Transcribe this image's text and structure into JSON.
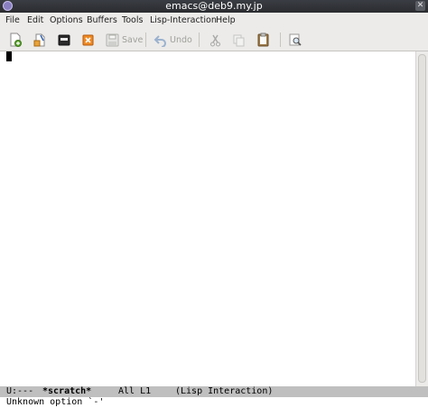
{
  "window": {
    "title": "emacs@deb9.my.jp",
    "app_icon": "emacs-icon",
    "close_glyph": "✕"
  },
  "menu": [
    {
      "label": "File"
    },
    {
      "label": "Edit"
    },
    {
      "label": "Options"
    },
    {
      "label": "Buffers"
    },
    {
      "label": "Tools"
    },
    {
      "label": "Lisp-Interaction"
    },
    {
      "label": "Help"
    }
  ],
  "toolbar": {
    "buttons": [
      {
        "icon": "new-file-icon",
        "enabled": true
      },
      {
        "icon": "open-file-icon",
        "enabled": true
      },
      {
        "icon": "dired-icon",
        "enabled": true
      },
      {
        "icon": "kill-buffer-icon",
        "enabled": true
      },
      {
        "icon": "save-icon",
        "label": "Save",
        "enabled": false
      },
      {
        "icon": "undo-icon",
        "label": "Undo",
        "enabled": false
      },
      {
        "icon": "cut-icon",
        "enabled": false
      },
      {
        "icon": "copy-icon",
        "enabled": false
      },
      {
        "icon": "paste-icon",
        "enabled": true
      },
      {
        "icon": "search-icon",
        "enabled": true
      }
    ]
  },
  "modeline": {
    "status": "U:---",
    "buffer": "*scratch*",
    "position": "All L1",
    "mode": "(Lisp Interaction)"
  },
  "echo_area": {
    "message": "Unknown option `-'"
  },
  "colors": {
    "modeline_bg": "#bfbfbf",
    "titlebar_bg": "#2e3035",
    "toolbar_bg": "#ecebe9"
  }
}
